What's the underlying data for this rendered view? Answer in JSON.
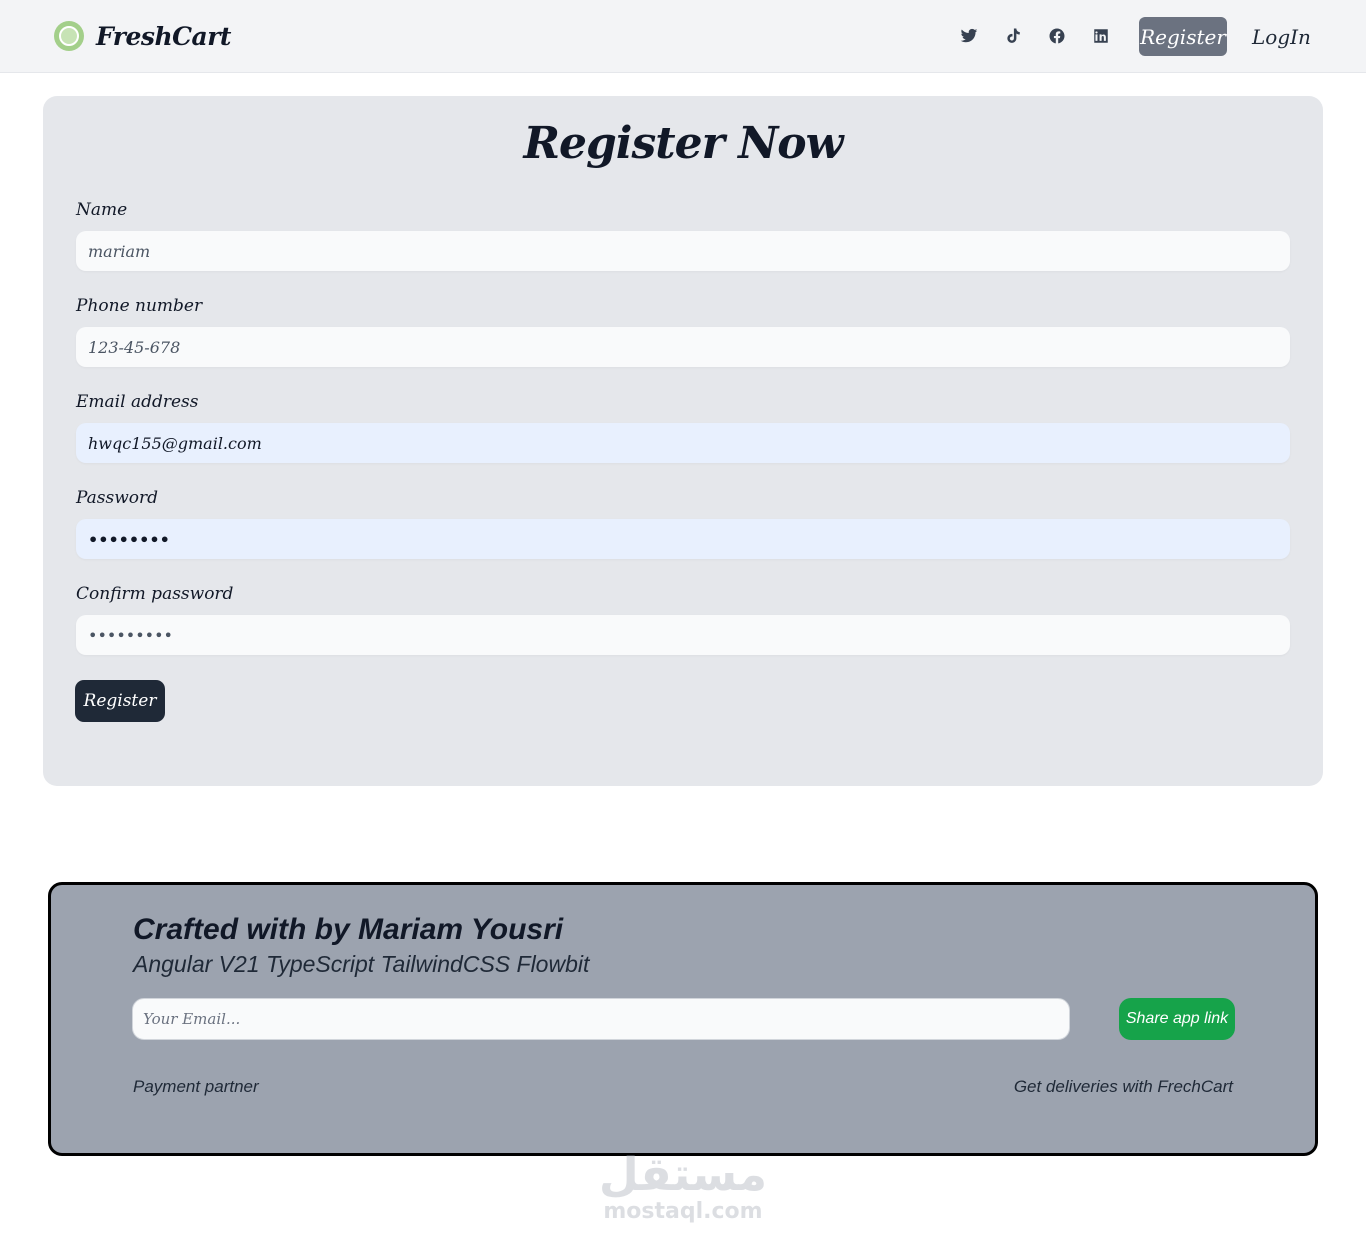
{
  "navbar": {
    "brand_name": "FreshCart",
    "social_icons": [
      "twitter-icon",
      "tiktok-icon",
      "facebook-icon",
      "linkedin-icon"
    ],
    "register_label": "Register",
    "login_label": "LogIn"
  },
  "form": {
    "title": "Register Now",
    "name_label": "Name",
    "name_value": "mariam",
    "phone_label": "Phone number",
    "phone_value": "123-45-678",
    "email_label": "Email address",
    "email_value": "hwqc155@gmail.com",
    "password_label": "Password",
    "password_value": "••••••••",
    "confirm_label": "Confirm password",
    "confirm_value": "•••••••••",
    "submit_label": "Register"
  },
  "footer": {
    "title": "Crafted with by Mariam Yousri",
    "subtitle": "Angular V21 TypeScript TailwindCSS Flowbit",
    "email_placeholder": "Your Email...",
    "share_label": "Share app link",
    "payment_label": "Payment partner",
    "deliveries_label": "Get deliveries with FrechCart"
  },
  "watermark": {
    "arabic": "مستقل",
    "latin": "mostaql.com"
  },
  "colors": {
    "navbar_bg": "#f3f4f6",
    "card_bg": "#e5e7eb",
    "nav_register_bg": "#6b7280",
    "submit_bg": "#1f2937",
    "footer_bg": "#9ca3af",
    "share_bg": "#16a34a"
  }
}
